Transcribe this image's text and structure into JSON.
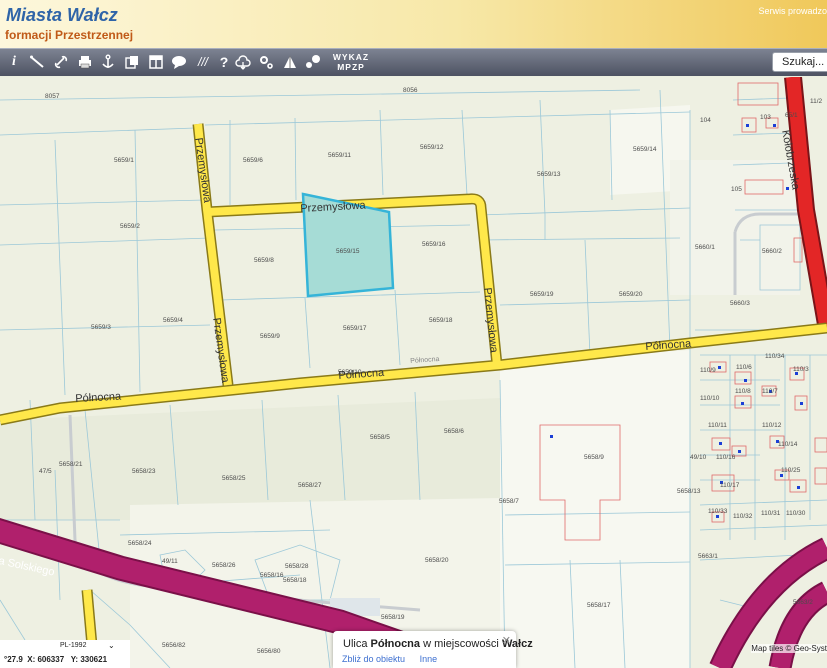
{
  "header": {
    "title": "Miasta Wałcz",
    "subtitle": "formacji Przestrzennej",
    "service_link": "Serwis prowadzo"
  },
  "toolbar": {
    "tools": [
      "info-icon",
      "measure-icon",
      "link-icon",
      "print-icon",
      "anchor-icon",
      "copy-icon",
      "layout-icon",
      "comment-icon",
      "hatch-icon",
      "help-icon",
      "cloud-icon",
      "settings-icon",
      "shapes-icon",
      "points-icon"
    ],
    "wykaz_label": "WYKAZ MPZP",
    "search_placeholder": "Szukaj..."
  },
  "map": {
    "road_labels": {
      "przemyslowa_top": "Przemysłowa",
      "przemyslowa_left": "Przemysłowa",
      "przemyslowa_right": "Przemysłowa",
      "polnocna_left": "Północna",
      "polnocna_mid": "Północna",
      "polnocna_right": "Północna",
      "polnocna_small": "Północna",
      "kolobrzeska": "Kołobrzeska",
      "solskiego": "a Solskiego"
    },
    "parcel_labels": [
      "8057",
      "8056",
      "5659/1",
      "5659/6",
      "5659/11",
      "5659/12",
      "5659/13",
      "5659/14",
      "5659/2",
      "5659/8",
      "5659/15",
      "5659/16",
      "5659/3",
      "5659/4",
      "5659/9",
      "5659/17",
      "5659/18",
      "5659/19",
      "5659/20",
      "5659/10",
      "104",
      "103",
      "105",
      "5660/1",
      "5660/2",
      "5660/3",
      "5658/5",
      "5658/6",
      "5658/9",
      "5658/21",
      "47/5",
      "5658/23",
      "5658/25",
      "5658/27",
      "5658/7",
      "5658/13",
      "5658/24",
      "49/11",
      "5658/26",
      "5658/28",
      "5658/16",
      "5658/18",
      "5658/20",
      "5658/19",
      "5658/17",
      "5656/82",
      "5656/80",
      "5663/1",
      "5663/2",
      "110/9",
      "110/6",
      "110/8",
      "110/7",
      "110/3",
      "110/34",
      "110/10",
      "110/11",
      "110/12",
      "110/14",
      "110/16",
      "110/25",
      "49/10",
      "110/17",
      "110/33",
      "110/32",
      "110/31",
      "110/30",
      "65/1",
      "11/2"
    ]
  },
  "coords": {
    "projection": "PL-1992",
    "prefix": "°27.9",
    "x": "X: 606337",
    "y": "Y: 330621"
  },
  "popup": {
    "prefix": "Ulica ",
    "street": "Północna",
    "middle": " w miejscowości ",
    "town": "Wałcz",
    "zoom_link": "Zbliż do obiektu",
    "other_link": "Inne"
  },
  "attribution": "Map tiles © Geo-Syst"
}
